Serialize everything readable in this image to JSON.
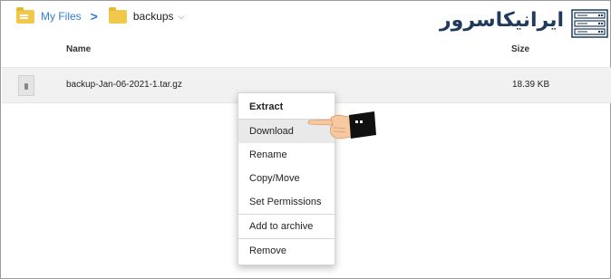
{
  "breadcrumb": {
    "root_label": "My Files",
    "separator": ">",
    "current_label": "backups",
    "dropdown_glyph": "⌄"
  },
  "table": {
    "columns": [
      "Name",
      "Size"
    ],
    "rows": [
      {
        "name": "backup-Jan-06-2021-1.tar.gz",
        "size": "18.39 KB",
        "icon": "archive-file-icon"
      }
    ]
  },
  "context_menu": {
    "items": [
      {
        "label": "Extract",
        "bold": true
      },
      {
        "label": "Download",
        "hover": true
      },
      {
        "label": "Rename"
      },
      {
        "label": "Copy/Move"
      },
      {
        "label": "Set Permissions"
      },
      {
        "label": "Add to archive"
      },
      {
        "label": "Remove"
      }
    ]
  },
  "logo": {
    "text": "ایرانیکاسرور",
    "icon": "server-rack-icon"
  },
  "colors": {
    "link": "#2f7fd2",
    "folder": "#f2c84b",
    "row_selected": "#f1f1f1",
    "menu_hover": "#e9e9e9",
    "logo": "#1f3a5c"
  }
}
